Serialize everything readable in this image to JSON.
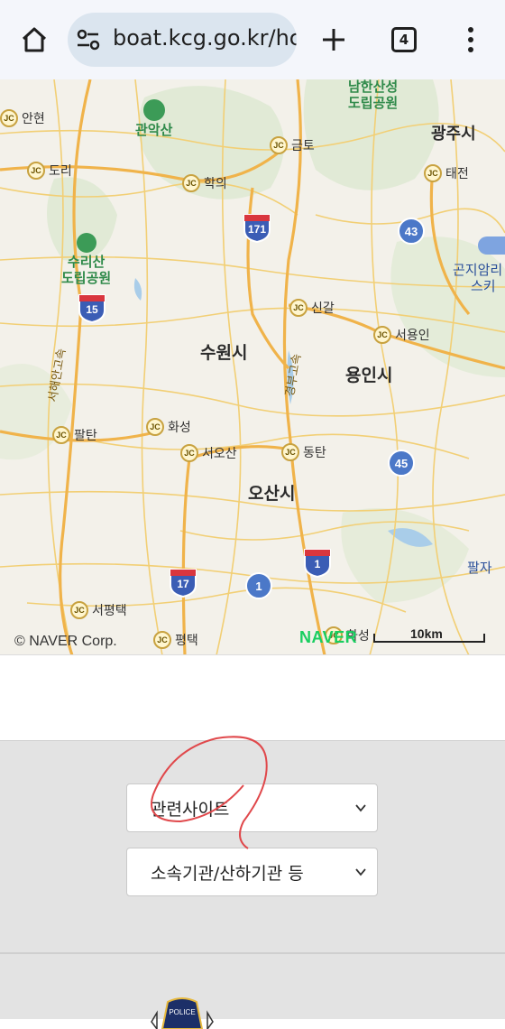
{
  "browser": {
    "url": "boat.kcg.go.kr/hc",
    "tab_count": "4"
  },
  "map": {
    "cities": [
      "수원시",
      "용인시",
      "오산시",
      "광주시"
    ],
    "parks": [
      {
        "line1": "남한산성",
        "line2": "도립공원"
      },
      {
        "line1": "수리산",
        "line2": "도립공원"
      },
      {
        "line1": "관악산",
        "line2": ""
      }
    ],
    "junctions": [
      "안현",
      "도리",
      "학의",
      "금토",
      "태전",
      "신갈",
      "서용인",
      "화성",
      "서오산",
      "동탄",
      "팔탄",
      "서평택",
      "평택",
      "화성"
    ],
    "routes": [
      "43",
      "45",
      "1"
    ],
    "shields": [
      "171",
      "15",
      "1",
      "17"
    ],
    "roads": [
      "서해안고속",
      "경부고속"
    ],
    "edge_labels": [
      "곤지암리",
      "스키",
      "팔자",
      "광주시"
    ],
    "copyright": "© NAVER Corp.",
    "brand": "NAVER",
    "scale": "10km"
  },
  "footer": {
    "select_related": "관련사이트",
    "select_agencies": "소속기관/산하기관 등",
    "logo_text": "POLICE"
  }
}
